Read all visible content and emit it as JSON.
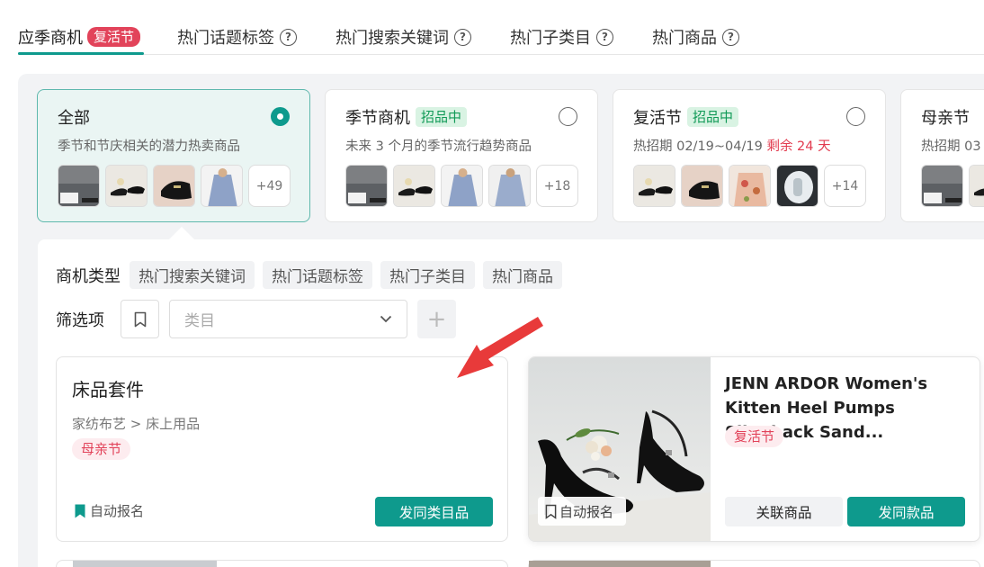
{
  "tabs": [
    {
      "label": "应季商机",
      "badge": "复活节",
      "active": true
    },
    {
      "label": "热门话题标签"
    },
    {
      "label": "热门搜索关键词"
    },
    {
      "label": "热门子类目"
    },
    {
      "label": "热门商品"
    }
  ],
  "opportunity_cards": [
    {
      "title": "全部",
      "desc": "季节和节庆相关的潜力热卖商品",
      "more": "+49",
      "selected": true
    },
    {
      "title": "季节商机",
      "status": "招品中",
      "desc": "未来 3 个月的季节流行趋势商品",
      "more": "+18"
    },
    {
      "title": "复活节",
      "status": "招品中",
      "desc": "热招期 02/19~04/19 ",
      "countdown": "剩余 24 天",
      "more": "+14"
    },
    {
      "title": "母亲节",
      "desc": "热招期 03"
    }
  ],
  "filters": {
    "type_label": "商机类型",
    "type_chips": [
      "热门搜索关键词",
      "热门话题标签",
      "热门子类目",
      "热门商品"
    ],
    "filter_label": "筛选项",
    "category_placeholder": "类目",
    "add_symbol": "+"
  },
  "category_card": {
    "title": "床品套件",
    "breadcrumb": "家纺布艺 > 床上用品",
    "tag": "母亲节",
    "auto_enroll": "自动报名",
    "action": "发同类目品"
  },
  "product_card": {
    "name": "JENN ARDOR Women's Kitten Heel Pumps Slingback Sand...",
    "tag": "复活节",
    "auto_enroll": "自动报名",
    "related": "关联商品",
    "action": "发同款品"
  },
  "colors": {
    "accent": "#0e9a8d",
    "badge_red": "#e2435a",
    "status_green": "#119a57",
    "arrow": "#e83a3a"
  }
}
